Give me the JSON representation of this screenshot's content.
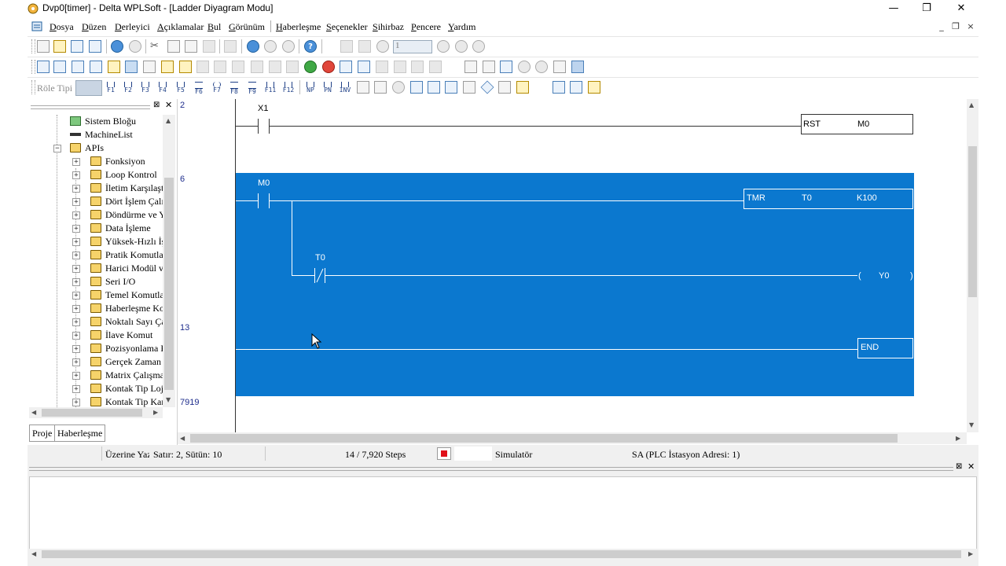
{
  "window": {
    "title": "Dvp0[timer] - Delta WPLSoft - [Ladder Diyagram Modu]",
    "controls": [
      "—",
      "❐",
      "✕"
    ]
  },
  "menu": [
    {
      "label": "Dosya",
      "underline": "D",
      "rest": "osya"
    },
    {
      "label": "Düzen",
      "underline": "D",
      "rest": "üzen"
    },
    {
      "label": "Derleyici",
      "underline": "D",
      "rest": "erleyici"
    },
    {
      "label": "Açıklamalar",
      "underline": "A",
      "rest": "çıklamalar"
    },
    {
      "label": "Bul",
      "underline": "B",
      "rest": "ul"
    },
    {
      "label": "Görünüm",
      "underline": "G",
      "rest": "örünüm"
    },
    {
      "label": "Haberleşme",
      "underline": "H",
      "rest": "aberleşme"
    },
    {
      "label": "Seçenekler",
      "underline": "S",
      "rest": "eçenekler"
    },
    {
      "label": "Sihirbaz",
      "underline": "S",
      "rest": "ihirbaz"
    },
    {
      "label": "Pencere",
      "underline": "P",
      "rest": "encere"
    },
    {
      "label": "Yardım",
      "underline": "Y",
      "rest": "ardım"
    }
  ],
  "mdi_controls": [
    "_",
    "❐",
    "×"
  ],
  "toolbar1": {
    "step_value": "1"
  },
  "toolbar3": {
    "role_label": "Röle Tipi",
    "fkeys": [
      "F1",
      "F2",
      "F3",
      "F4",
      "F5",
      "F6",
      "F7",
      "F8",
      "F9",
      "F11",
      "F12"
    ],
    "extra": [
      "NP",
      "PN",
      "INV"
    ]
  },
  "left_panel": {
    "tree": [
      {
        "label": "Sistem Bloğu",
        "level": 1,
        "expander": ""
      },
      {
        "label": "MachineList",
        "level": 1,
        "expander": ""
      },
      {
        "label": "APIs",
        "level": 1,
        "expander": "−"
      },
      {
        "label": "Fonksiyon",
        "level": 2,
        "expander": "+"
      },
      {
        "label": "Loop Kontrol",
        "level": 2,
        "expander": "+"
      },
      {
        "label": "İletim Karşılaştı",
        "level": 2,
        "expander": "+"
      },
      {
        "label": "Dört İşlem Çalış",
        "level": 2,
        "expander": "+"
      },
      {
        "label": "Döndürme ve Y",
        "level": 2,
        "expander": "+"
      },
      {
        "label": "Data İşleme",
        "level": 2,
        "expander": "+"
      },
      {
        "label": "Yüksek-Hızlı İş",
        "level": 2,
        "expander": "+"
      },
      {
        "label": "Pratik Komutlar",
        "level": 2,
        "expander": "+"
      },
      {
        "label": "Harici Modül ve",
        "level": 2,
        "expander": "+"
      },
      {
        "label": "Seri I/O",
        "level": 2,
        "expander": "+"
      },
      {
        "label": "Temel Komutlar",
        "level": 2,
        "expander": "+"
      },
      {
        "label": "Haberleşme Kor",
        "level": 2,
        "expander": "+"
      },
      {
        "label": "Noktalı Sayı Ça",
        "level": 2,
        "expander": "+"
      },
      {
        "label": "İlave Komut",
        "level": 2,
        "expander": "+"
      },
      {
        "label": "Pozisyonlama K",
        "level": 2,
        "expander": "+"
      },
      {
        "label": "Gerçek Zaman T",
        "level": 2,
        "expander": "+"
      },
      {
        "label": "Matrix Çalışma",
        "level": 2,
        "expander": "+"
      },
      {
        "label": "Kontak Tip Loj",
        "level": 2,
        "expander": "+"
      },
      {
        "label": "Kontak Tip Kar",
        "level": 2,
        "expander": "+"
      }
    ],
    "tabs": [
      "Proje",
      "Haberleşme"
    ]
  },
  "ladder": {
    "rung_numbers": {
      "r1": "2",
      "r2": "6",
      "r3": "13",
      "r4": "7919"
    },
    "contacts": {
      "x1": "X1",
      "m0": "M0",
      "t0": "T0"
    },
    "rst": {
      "op": "RST",
      "arg": "M0"
    },
    "tmr": {
      "op": "TMR",
      "arg1": "T0",
      "arg2": "K100"
    },
    "coil": {
      "open": "(",
      "arg": "Y0",
      "close": ")"
    },
    "end": "END"
  },
  "status": {
    "mode": "Üzerine Yaz",
    "position": "Satır: 2, Sütün: 10",
    "steps": "14 / 7,920 Steps",
    "simulator": "Simulatör",
    "station": "SA (PLC İstasyon Adresi: 1)"
  },
  "colors": {
    "selection": "#0b78cf",
    "rung_number": "#1e2d8c",
    "sim_indicator": "#e0101a"
  }
}
